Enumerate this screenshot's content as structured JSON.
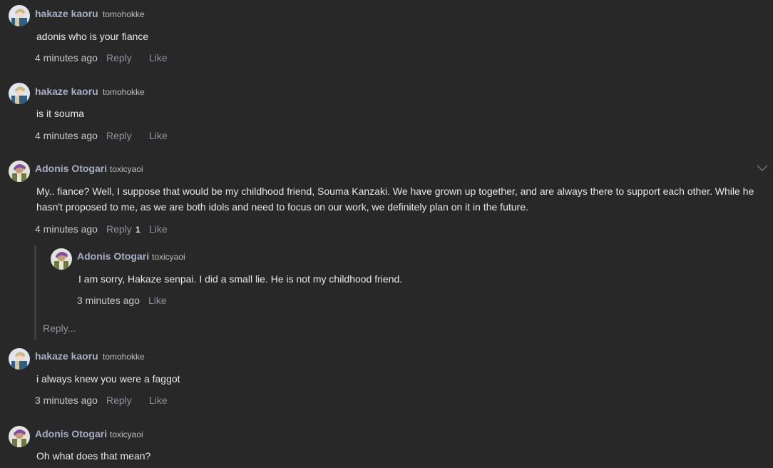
{
  "comments": [
    {
      "author": "hakaze kaoru",
      "handle": "tomohokke",
      "avatar_icon": "blue-hair-avatar",
      "text": "adonis who is your fiance",
      "time": "4 minutes ago",
      "reply_label": "Reply",
      "like_label": "Like"
    },
    {
      "author": "hakaze kaoru",
      "handle": "tomohokke",
      "avatar_icon": "blue-hair-avatar",
      "text": "is it souma",
      "time": "4 minutes ago",
      "reply_label": "Reply",
      "like_label": "Like"
    },
    {
      "author": "Adonis Otogari",
      "handle": "toxicyaoi",
      "avatar_icon": "purple-hair-avatar",
      "text": "My.. fiance? Well, I suppose that would be my childhood friend, Souma Kanzaki. We have grown up together, and are always there to support each other. While he hasn't proposed to me, as we are both idols and need to focus on our work, we definitely plan on it in the future.",
      "time": "4 minutes ago",
      "reply_label": "Reply",
      "reply_count": "1",
      "like_label": "Like",
      "menu_icon": "chevron-down-icon",
      "replies": [
        {
          "author": "Adonis Otogari",
          "handle": "toxicyaoi",
          "avatar_icon": "purple-hair-avatar",
          "text": "I am sorry, Hakaze senpai. I did a small lie. He is not my childhood friend.",
          "time": "3 minutes ago",
          "like_label": "Like"
        }
      ],
      "reply_input_label": "Reply..."
    },
    {
      "author": "hakaze kaoru",
      "handle": "tomohokke",
      "avatar_icon": "blue-hair-avatar",
      "text": "i always knew you were a faggot",
      "time": "3 minutes ago",
      "reply_label": "Reply",
      "like_label": "Like"
    },
    {
      "author": "Adonis Otogari",
      "handle": "toxicyaoi",
      "avatar_icon": "purple-hair-avatar",
      "text": "Oh what does that mean?"
    }
  ],
  "colors": {
    "background": "#282828",
    "author_name": "#a7aec4",
    "link": "#8f93a0",
    "text": "#e8e8e8"
  }
}
